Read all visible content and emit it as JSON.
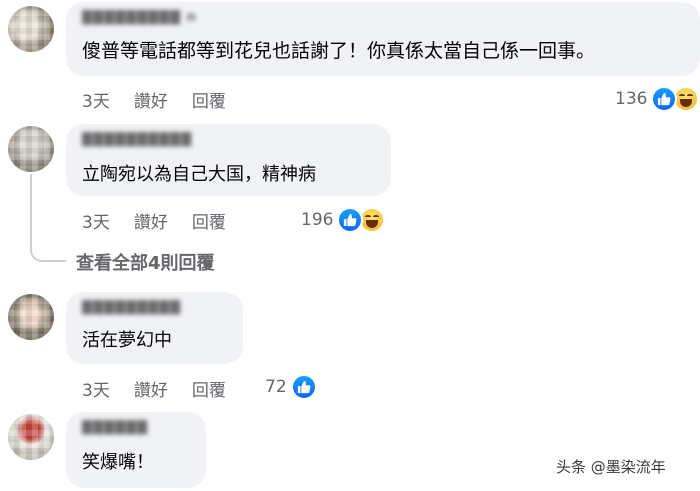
{
  "comments": [
    {
      "author": "█████████ n",
      "text": "傻普等電話都等到花兒也話謝了！你真係太當自己係一回事。",
      "time": "3天",
      "like_label": "讚好",
      "reply_label": "回覆",
      "reaction_count": "136",
      "reactions": [
        "like-icon",
        "haha-icon"
      ]
    },
    {
      "author": "██████████",
      "text": "立陶宛以為自己大国，精神病",
      "time": "3天",
      "like_label": "讚好",
      "reply_label": "回覆",
      "reaction_count": "196",
      "reactions": [
        "like-icon",
        "haha-icon"
      ]
    },
    {
      "author": "█████████",
      "text": "活在夢幻中",
      "time": "3天",
      "like_label": "讚好",
      "reply_label": "回覆",
      "reaction_count": "72",
      "reactions": [
        "like-icon"
      ]
    },
    {
      "author": "██████",
      "text": "笑爆嘴！"
    }
  ],
  "view_replies": "查看全部4則回覆",
  "watermark": "头条 @墨染流年",
  "colors": {
    "bubble": "#f0f2f5",
    "meta_text": "#65676b",
    "like_blue": "#0866ff",
    "haha_yellow": "#f7b125"
  }
}
